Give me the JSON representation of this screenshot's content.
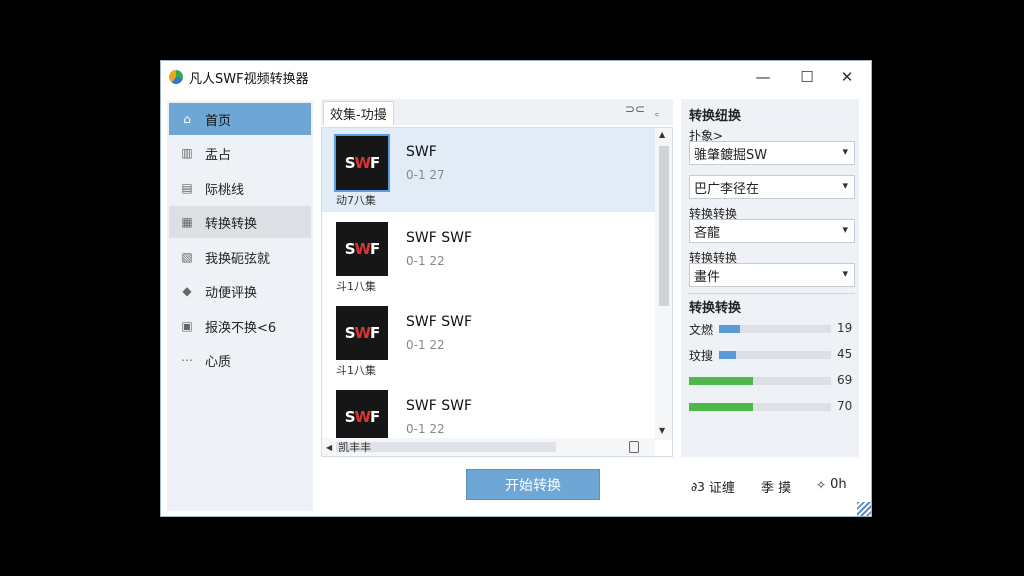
{
  "window": {
    "title": "凡人SWF视频转换器",
    "min_glyph": "—",
    "max_glyph": "☐",
    "close_glyph": "✕"
  },
  "sidebar": {
    "items": [
      {
        "label": "首页",
        "icon": "home-icon",
        "glyph": "⌂"
      },
      {
        "label": "盂占",
        "icon": "trash-icon",
        "glyph": "▥"
      },
      {
        "label": "际桃线",
        "icon": "file-icon",
        "glyph": "▤"
      },
      {
        "label": "转换转换",
        "icon": "document-icon",
        "glyph": "▦"
      },
      {
        "label": "我换砈弦就",
        "icon": "edit-icon",
        "glyph": "▧"
      },
      {
        "label": "动便评换",
        "icon": "tag-icon",
        "glyph": "◆"
      },
      {
        "label": "报涣不换<6",
        "icon": "folder-icon",
        "glyph": "▣"
      },
      {
        "label": "心质",
        "icon": "dots-icon",
        "glyph": "⋯"
      }
    ]
  },
  "center": {
    "tab_label": "效集-功摱",
    "tab_ctl_1": "⊃⊂",
    "tab_ctl_2": "꜀",
    "scroll_up": "▲",
    "scroll_down": "▼",
    "hscroll_left": "◀",
    "hscroll_label": "凯丰丰",
    "files": [
      {
        "thumb_text": "SWF",
        "caption": "动7八集",
        "name": "SWF",
        "meta": "0-1 27"
      },
      {
        "thumb_text": "SWF",
        "caption": "斗1八集",
        "name": "SWF SWF",
        "meta": "0-1 22"
      },
      {
        "thumb_text": "SWF",
        "caption": "斗1八集",
        "name": "SWF SWF",
        "meta": "0-1 22"
      },
      {
        "thumb_text": "SWF",
        "caption": "",
        "name": "SWF SWF",
        "meta": "0-1 22"
      }
    ]
  },
  "start_button": "开始转换",
  "right": {
    "section1_title": "转换纽换",
    "field1_label": "扑象>",
    "select1_value": "骓肇鍍掘SW",
    "select2_value": "巴广李径在",
    "field2_label": "转换转换",
    "select3_value": "吝龍",
    "field3_label": "转换转换",
    "select4_value": "畫件",
    "section2_title": "转换转换",
    "arrow": "▾",
    "bars": [
      {
        "label": "文燃",
        "value": 19,
        "value_text": "19",
        "color": "#5b9bd5"
      },
      {
        "label": "玟搜",
        "value": 15,
        "value_text": "45",
        "color": "#5b9bd5"
      },
      {
        "label": "",
        "value": 45,
        "value_text": "69",
        "color": "#4cb84a"
      },
      {
        "label": "",
        "value": 45,
        "value_text": "70",
        "color": "#4cb84a"
      }
    ]
  },
  "bottom_actions": [
    {
      "icon": "link-icon",
      "glyph": "∂3",
      "label": "证缠"
    },
    {
      "icon": "",
      "glyph": "",
      "label": "季 摸"
    },
    {
      "icon": "settings-icon",
      "glyph": "✧",
      "label": "0h"
    }
  ]
}
